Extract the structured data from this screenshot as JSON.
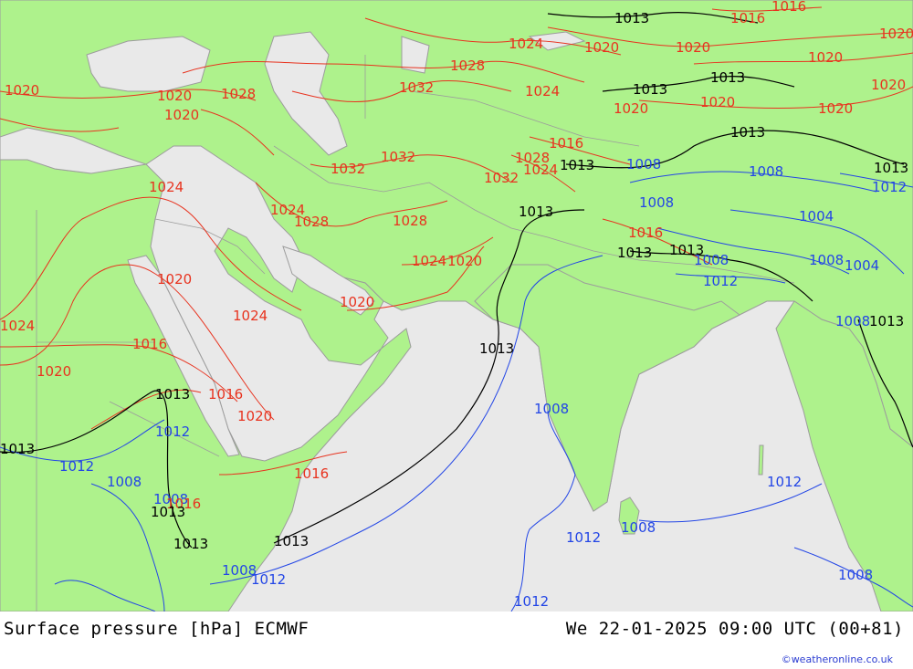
{
  "map": {
    "colors": {
      "land": "#aef28c",
      "sea": "#e9e9e9",
      "border": "#9c9c9c",
      "isobar_high": "#e8331f",
      "isobar_low": "#2346e6",
      "isobar_1013": "#000000"
    },
    "isobar_labels": [
      {
        "text": "1013",
        "kind": "1013"
      },
      {
        "text": "1016",
        "kind": "high"
      },
      {
        "text": "1016",
        "kind": "high"
      },
      {
        "text": "1024",
        "kind": "high"
      },
      {
        "text": "1020",
        "kind": "high"
      },
      {
        "text": "1020",
        "kind": "high"
      },
      {
        "text": "1020",
        "kind": "high"
      },
      {
        "text": "1028",
        "kind": "high"
      },
      {
        "text": "1013",
        "kind": "1013"
      },
      {
        "text": "1020",
        "kind": "high"
      },
      {
        "text": "1020",
        "kind": "high"
      },
      {
        "text": "1032",
        "kind": "high"
      },
      {
        "text": "1024",
        "kind": "high"
      },
      {
        "text": "1013",
        "kind": "1013"
      },
      {
        "text": "1020",
        "kind": "high"
      },
      {
        "text": "1020",
        "kind": "high"
      },
      {
        "text": "1020",
        "kind": "high"
      },
      {
        "text": "1020",
        "kind": "high"
      },
      {
        "text": "1028",
        "kind": "high"
      },
      {
        "text": "1020",
        "kind": "high"
      },
      {
        "text": "1020",
        "kind": "high"
      },
      {
        "text": "1013",
        "kind": "1013"
      },
      {
        "text": "1016",
        "kind": "high"
      },
      {
        "text": "1032",
        "kind": "high"
      },
      {
        "text": "1032",
        "kind": "high"
      },
      {
        "text": "1028",
        "kind": "high"
      },
      {
        "text": "1024",
        "kind": "high"
      },
      {
        "text": "1013",
        "kind": "1013"
      },
      {
        "text": "1008",
        "kind": "low"
      },
      {
        "text": "1008",
        "kind": "low"
      },
      {
        "text": "1013",
        "kind": "1013"
      },
      {
        "text": "1024",
        "kind": "high"
      },
      {
        "text": "1032",
        "kind": "high"
      },
      {
        "text": "1012",
        "kind": "low"
      },
      {
        "text": "1024",
        "kind": "high"
      },
      {
        "text": "1013",
        "kind": "1013"
      },
      {
        "text": "1028",
        "kind": "high"
      },
      {
        "text": "1028",
        "kind": "high"
      },
      {
        "text": "1008",
        "kind": "low"
      },
      {
        "text": "1004",
        "kind": "low"
      },
      {
        "text": "1013",
        "kind": "1013"
      },
      {
        "text": "1013",
        "kind": "1013"
      },
      {
        "text": "1024",
        "kind": "high"
      },
      {
        "text": "1020",
        "kind": "high"
      },
      {
        "text": "1016",
        "kind": "high"
      },
      {
        "text": "1008",
        "kind": "low"
      },
      {
        "text": "1008",
        "kind": "low"
      },
      {
        "text": "1004",
        "kind": "low"
      },
      {
        "text": "1012",
        "kind": "low"
      },
      {
        "text": "1020",
        "kind": "high"
      },
      {
        "text": "1020",
        "kind": "high"
      },
      {
        "text": "1024",
        "kind": "high"
      },
      {
        "text": "1013",
        "kind": "1013"
      },
      {
        "text": "1024",
        "kind": "high"
      },
      {
        "text": "1016",
        "kind": "high"
      },
      {
        "text": "1013",
        "kind": "1013"
      },
      {
        "text": "1020",
        "kind": "high"
      },
      {
        "text": "1008",
        "kind": "low"
      },
      {
        "text": "1013",
        "kind": "1013"
      },
      {
        "text": "1016",
        "kind": "high"
      },
      {
        "text": "1020",
        "kind": "high"
      },
      {
        "text": "1012",
        "kind": "low"
      },
      {
        "text": "1013",
        "kind": "1013"
      },
      {
        "text": "1012",
        "kind": "low"
      },
      {
        "text": "1008",
        "kind": "low"
      },
      {
        "text": "1016",
        "kind": "high"
      },
      {
        "text": "1008",
        "kind": "low"
      },
      {
        "text": "1013",
        "kind": "1013"
      },
      {
        "text": "1016",
        "kind": "high"
      },
      {
        "text": "1013",
        "kind": "1013"
      },
      {
        "text": "1013",
        "kind": "1013"
      },
      {
        "text": "1008",
        "kind": "low"
      },
      {
        "text": "1008",
        "kind": "low"
      },
      {
        "text": "1012",
        "kind": "low"
      },
      {
        "text": "1012",
        "kind": "low"
      },
      {
        "text": "1008",
        "kind": "low"
      },
      {
        "text": "1012",
        "kind": "low"
      },
      {
        "text": "1012",
        "kind": "low"
      },
      {
        "text": "1008",
        "kind": "low"
      }
    ]
  },
  "footer": {
    "title": "Surface pressure [hPa] ECMWF",
    "datetime": "We 22-01-2025 09:00 UTC (00+81)",
    "credit": "©weatheronline.co.uk"
  }
}
